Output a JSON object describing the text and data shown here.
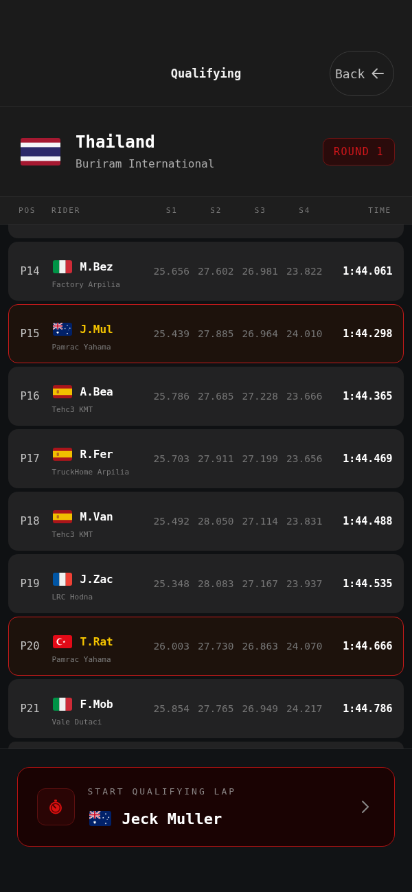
{
  "header": {
    "title": "Qualifying",
    "back_button": "Back"
  },
  "event": {
    "flag": {
      "kind": "thailand"
    },
    "country": "Thailand",
    "circuit": "Buriram International",
    "round": "ROUND 1"
  },
  "table": {
    "columns": [
      "POS",
      "RIDER",
      "S1",
      "S2",
      "S3",
      "S4",
      "TIME"
    ],
    "rows": [
      {
        "pos": "P14",
        "flag": {
          "kind": "italy"
        },
        "rider": "M.Bez",
        "team": "Factory Arpilia",
        "sectors": [
          "25.656",
          "27.602",
          "26.981",
          "23.822"
        ],
        "time": "1:44.061",
        "highlighted": false
      },
      {
        "pos": "P15",
        "flag": {
          "kind": "australia"
        },
        "rider": "J.Mul",
        "team": "Pamrac Yahama",
        "sectors": [
          "25.439",
          "27.885",
          "26.964",
          "24.010"
        ],
        "time": "1:44.298",
        "highlighted": true
      },
      {
        "pos": "P16",
        "flag": {
          "kind": "spain"
        },
        "rider": "A.Bea",
        "team": "Tehc3 KMT",
        "sectors": [
          "25.786",
          "27.685",
          "27.228",
          "23.666"
        ],
        "time": "1:44.365",
        "highlighted": false
      },
      {
        "pos": "P17",
        "flag": {
          "kind": "spain"
        },
        "rider": "R.Fer",
        "team": "TruckHome Arpilia",
        "sectors": [
          "25.703",
          "27.911",
          "27.199",
          "23.656"
        ],
        "time": "1:44.469",
        "highlighted": false
      },
      {
        "pos": "P18",
        "flag": {
          "kind": "spain"
        },
        "rider": "M.Van",
        "team": "Tehc3 KMT",
        "sectors": [
          "25.492",
          "28.050",
          "27.114",
          "23.831"
        ],
        "time": "1:44.488",
        "highlighted": false
      },
      {
        "pos": "P19",
        "flag": {
          "kind": "france"
        },
        "rider": "J.Zac",
        "team": "LRC Hodna",
        "sectors": [
          "25.348",
          "28.083",
          "27.167",
          "23.937"
        ],
        "time": "1:44.535",
        "highlighted": false
      },
      {
        "pos": "P20",
        "flag": {
          "kind": "turkey"
        },
        "rider": "T.Rat",
        "team": "Pamrac Yahama",
        "sectors": [
          "26.003",
          "27.730",
          "26.863",
          "24.070"
        ],
        "time": "1:44.666",
        "highlighted": true
      },
      {
        "pos": "P21",
        "flag": {
          "kind": "italy"
        },
        "rider": "F.Mob",
        "team": "Vale Dutaci",
        "sectors": [
          "25.854",
          "27.765",
          "26.949",
          "24.217"
        ],
        "time": "1:44.786",
        "highlighted": false
      }
    ]
  },
  "start_lap": {
    "label": "START QUALIFYING LAP",
    "flag": {
      "kind": "australia"
    },
    "rider": "Jeck Muller"
  }
}
